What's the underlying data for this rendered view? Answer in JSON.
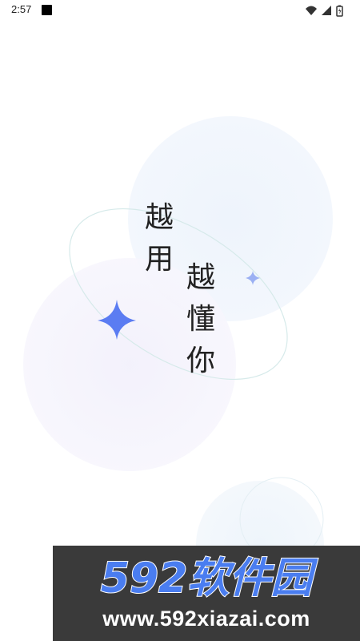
{
  "status_bar": {
    "time": "2:57",
    "icons": [
      "notification-square-icon",
      "wifi-icon",
      "signal-icon",
      "battery-icon"
    ]
  },
  "slogan": {
    "column_left": [
      "越",
      "用"
    ],
    "column_right": [
      "越",
      "懂",
      "你"
    ]
  },
  "watermark": {
    "logo_text": "592软件园",
    "url": "www.592xiazai.com"
  },
  "colors": {
    "background": "#ffffff",
    "text": "#222222",
    "sparkle": "#5b7cf2",
    "watermark_bg": "#3a3a3a",
    "watermark_logo": "#4a7df0"
  }
}
